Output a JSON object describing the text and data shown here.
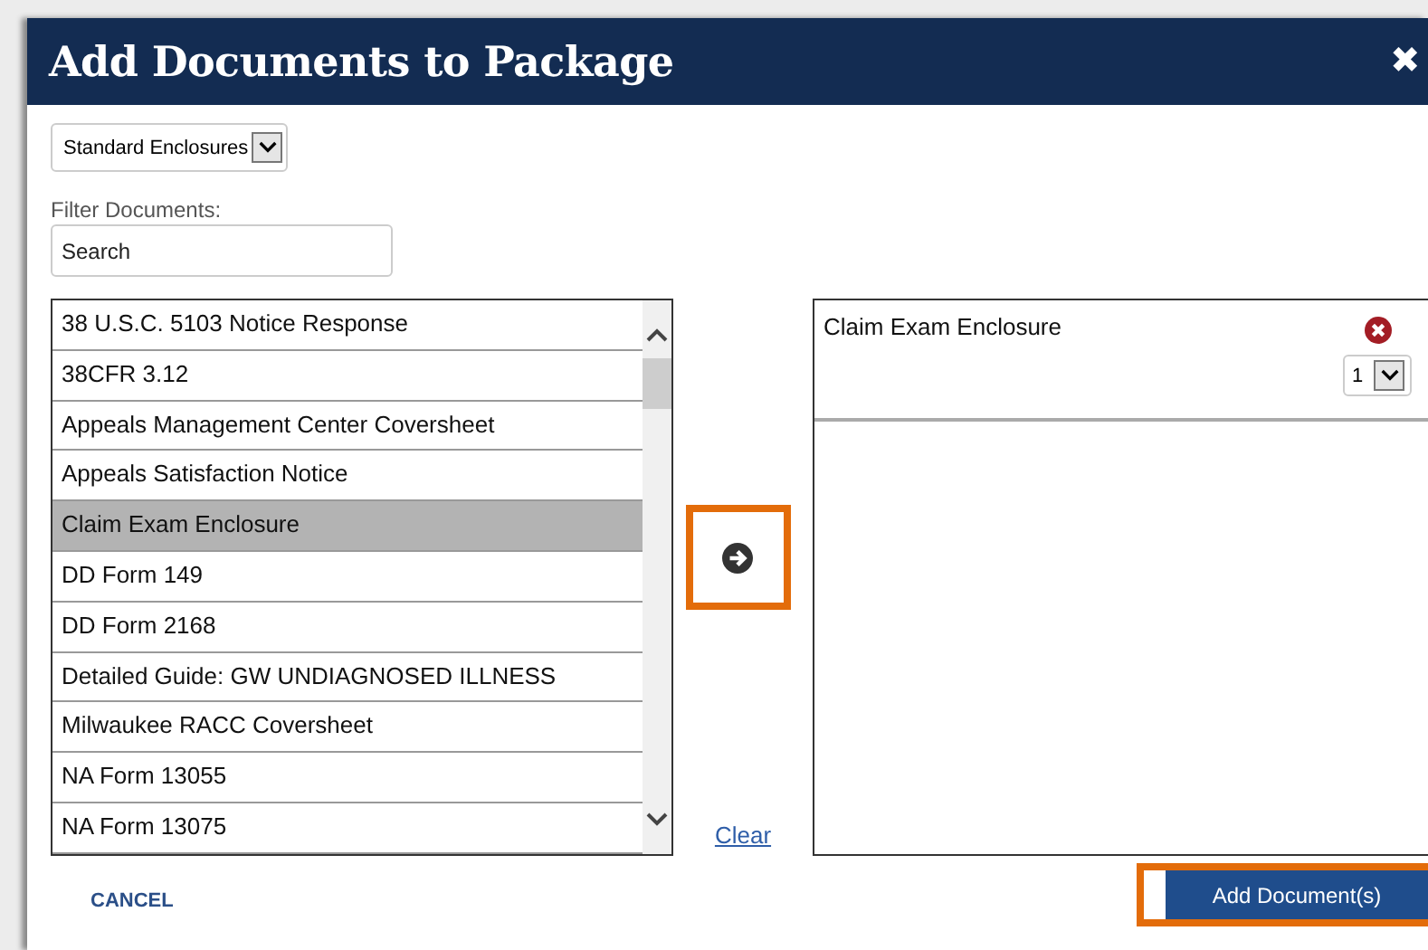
{
  "dialog": {
    "title": "Add Documents to Package",
    "close": "✖"
  },
  "category_select": {
    "value": "Standard Enclosures"
  },
  "filter": {
    "label": "Filter Documents:",
    "placeholder": "Search"
  },
  "documents": [
    {
      "name": "38 U.S.C. 5103 Notice Response",
      "selected": false
    },
    {
      "name": "38CFR 3.12",
      "selected": false
    },
    {
      "name": "Appeals Management Center Coversheet",
      "selected": false
    },
    {
      "name": "Appeals Satisfaction Notice",
      "selected": false
    },
    {
      "name": "Claim Exam Enclosure",
      "selected": true
    },
    {
      "name": "DD Form 149",
      "selected": false
    },
    {
      "name": "DD Form 2168",
      "selected": false
    },
    {
      "name": "Detailed Guide: GW UNDIAGNOSED ILLNESS",
      "selected": false
    },
    {
      "name": "Milwaukee RACC Coversheet",
      "selected": false
    },
    {
      "name": "NA Form 13055",
      "selected": false
    },
    {
      "name": "NA Form 13075",
      "selected": false
    }
  ],
  "move_button": {
    "highlighted": true
  },
  "clear_link": "Clear",
  "package_items": [
    {
      "name": "Claim Exam Enclosure",
      "quantity": "1"
    }
  ],
  "cancel_button": "CANCEL",
  "add_button": {
    "label": "Add Document(s)",
    "highlighted": true
  }
}
